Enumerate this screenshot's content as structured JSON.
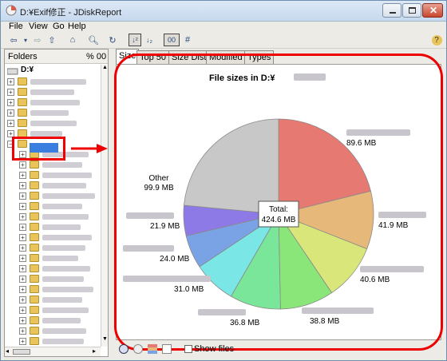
{
  "window": {
    "title": "D:¥Exif修正 - JDiskReport"
  },
  "menu": [
    "File",
    "View",
    "Go",
    "Help"
  ],
  "left_panel": {
    "header_folders": "Folders",
    "header_pct": "% 00",
    "drive": "D:¥"
  },
  "tabs": [
    "Size",
    "Top 50",
    "Size Dist",
    "Modified",
    "Types"
  ],
  "status": {
    "show_files_label": "Show files"
  },
  "chart_data": {
    "type": "pie",
    "title": "File sizes in D:¥",
    "center_label": "Total:",
    "center_value": "424.6 MB",
    "slices": [
      {
        "label": "",
        "value": 89.6,
        "display": "89.6 MB",
        "color": "#e67a73"
      },
      {
        "label": "",
        "value": 41.9,
        "display": "41.9 MB",
        "color": "#e6b87a"
      },
      {
        "label": "",
        "value": 40.6,
        "display": "40.6 MB",
        "color": "#d9e67a"
      },
      {
        "label": "",
        "value": 38.8,
        "display": "38.8 MB",
        "color": "#8be67a"
      },
      {
        "label": "",
        "value": 36.8,
        "display": "36.8 MB",
        "color": "#7ae699"
      },
      {
        "label": "",
        "value": 31.0,
        "display": "31.0 MB",
        "color": "#7ae6e6"
      },
      {
        "label": "",
        "value": 24.0,
        "display": "24.0 MB",
        "color": "#7aa3e6"
      },
      {
        "label": "",
        "value": 21.9,
        "display": "21.9 MB",
        "color": "#8e7ae6"
      },
      {
        "label": "Other",
        "value": 99.9,
        "display": "99.9 MB",
        "color": "#c8c8c8"
      }
    ]
  }
}
